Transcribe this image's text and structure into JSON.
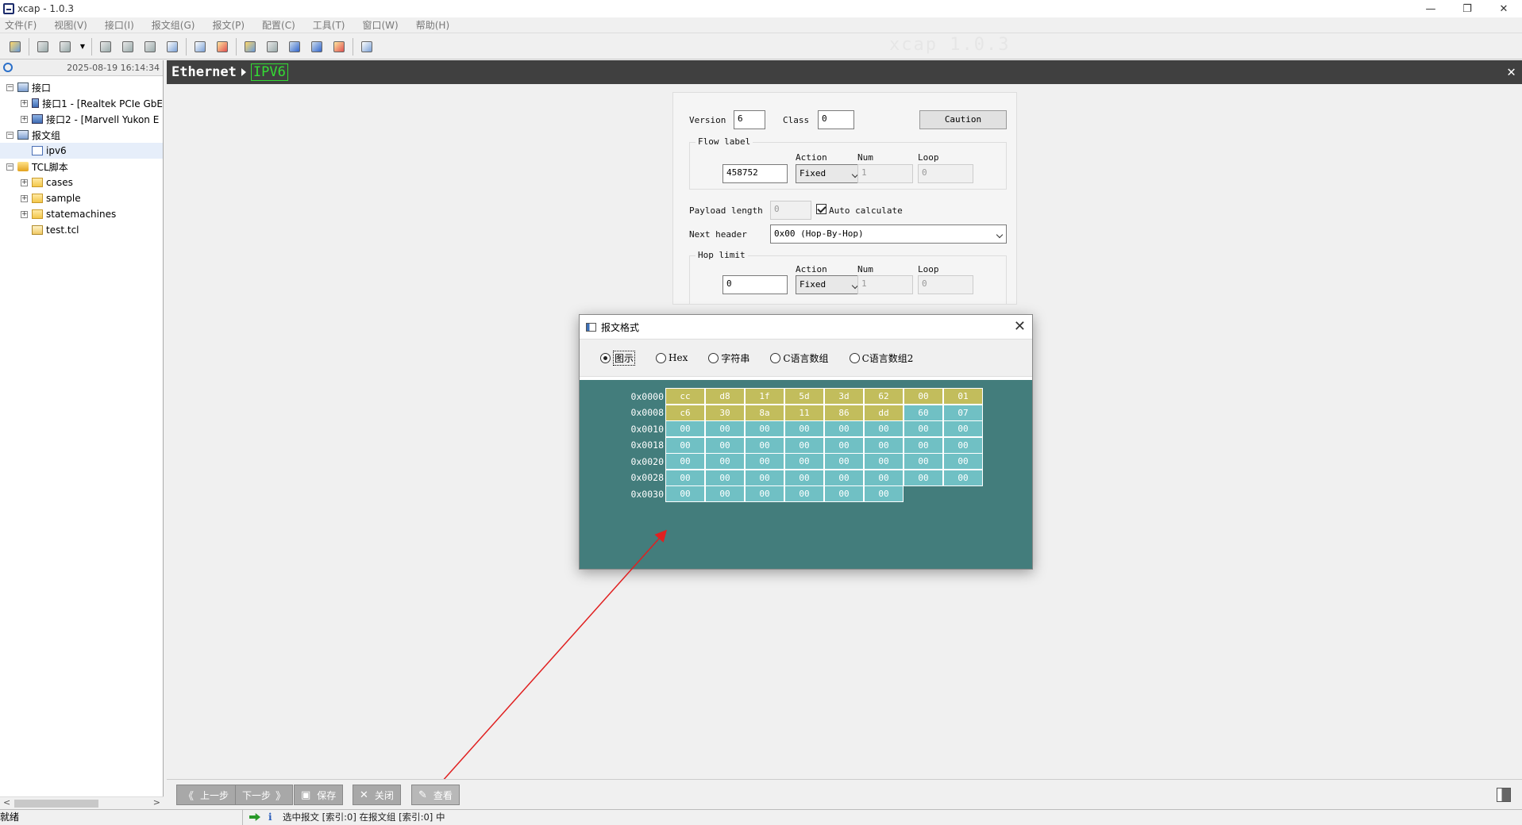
{
  "window": {
    "title": "xcap - 1.0.3",
    "controls": [
      "—",
      "❐",
      "✕"
    ]
  },
  "menu": [
    "文件(F)",
    "视图(V)",
    "接口(I)",
    "报文组(G)",
    "报文(P)",
    "配置(C)",
    "工具(T)",
    "窗口(W)",
    "帮助(H)"
  ],
  "watermark": "xcap 1.0.3",
  "sidebar": {
    "datetime": "2025-08-19 16:14:34",
    "tree": [
      {
        "label": "接口",
        "level": 0,
        "expander": "−",
        "icon": "nic-group"
      },
      {
        "label": "接口1 - [Realtek PCIe GbE",
        "level": 1,
        "expander": "+",
        "icon": "nic"
      },
      {
        "label": "接口2 - [Marvell Yukon E",
        "level": 1,
        "expander": "+",
        "icon": "nic"
      },
      {
        "label": "报文组",
        "level": 0,
        "expander": "−",
        "icon": "group"
      },
      {
        "label": "ipv6",
        "level": 1,
        "expander": "",
        "icon": "packet",
        "selected": true
      },
      {
        "label": "TCL脚本",
        "level": 0,
        "expander": "−",
        "icon": "tcl"
      },
      {
        "label": "cases",
        "level": 1,
        "expander": "+",
        "icon": "folder"
      },
      {
        "label": "sample",
        "level": 1,
        "expander": "+",
        "icon": "folder"
      },
      {
        "label": "statemachines",
        "level": 1,
        "expander": "+",
        "icon": "folder"
      },
      {
        "label": "test.tcl",
        "level": 1,
        "expander": "",
        "icon": "file"
      }
    ]
  },
  "breadcrumb": {
    "root": "Ethernet",
    "active": "IPV6",
    "close": "✕"
  },
  "ipv6_form": {
    "version_label": "Version",
    "version_value": "6",
    "class_label": "Class",
    "class_value": "0",
    "caution_button": "Caution",
    "flow_label_title": "Flow label",
    "flow": {
      "value": "458752",
      "action_label": "Action",
      "action": "Fixed",
      "num_label": "Num",
      "num": "1",
      "loop_label": "Loop",
      "loop": "0"
    },
    "payload_label": "Payload length",
    "payload_value": "0",
    "auto_calc_label": "Auto calculate",
    "next_header_label": "Next header",
    "next_header_value": "0x00 (Hop-By-Hop)",
    "hop_limit_title": "Hop limit",
    "hop": {
      "value": "0",
      "action_label": "Action",
      "action": "Fixed",
      "num_label": "Num",
      "num": "1",
      "loop_label": "Loop",
      "loop": "0"
    }
  },
  "dialog": {
    "title": "报文格式",
    "close": "✕",
    "radios": [
      {
        "label": "图示",
        "checked": true
      },
      {
        "label": "Hex",
        "checked": false
      },
      {
        "label": "字符串",
        "checked": false
      },
      {
        "label": "C语言数组",
        "checked": false
      },
      {
        "label": "C语言数组2",
        "checked": false
      }
    ],
    "hex_rows": [
      {
        "offset": "0x0000",
        "bytes": [
          "cc",
          "d8",
          "1f",
          "5d",
          "3d",
          "62",
          "00",
          "01"
        ],
        "header_count": 8
      },
      {
        "offset": "0x0008",
        "bytes": [
          "c6",
          "30",
          "8a",
          "11",
          "86",
          "dd",
          "60",
          "07"
        ],
        "header_count": 6
      },
      {
        "offset": "0x0010",
        "bytes": [
          "00",
          "00",
          "00",
          "00",
          "00",
          "00",
          "00",
          "00"
        ],
        "header_count": 0
      },
      {
        "offset": "0x0018",
        "bytes": [
          "00",
          "00",
          "00",
          "00",
          "00",
          "00",
          "00",
          "00"
        ],
        "header_count": 0
      },
      {
        "offset": "0x0020",
        "bytes": [
          "00",
          "00",
          "00",
          "00",
          "00",
          "00",
          "00",
          "00"
        ],
        "header_count": 0
      },
      {
        "offset": "0x0028",
        "bytes": [
          "00",
          "00",
          "00",
          "00",
          "00",
          "00",
          "00",
          "00"
        ],
        "header_count": 0
      },
      {
        "offset": "0x0030",
        "bytes": [
          "00",
          "00",
          "00",
          "00",
          "00",
          "00"
        ],
        "header_count": 0
      }
    ]
  },
  "bottom_buttons": [
    {
      "glyph": "《",
      "label": "上一步"
    },
    {
      "glyph": "》",
      "label": "下一步",
      "glyph_after": true
    },
    {
      "glyph": "▣",
      "label": "保存"
    },
    {
      "glyph": "✕",
      "label": "关闭"
    },
    {
      "glyph": "✎",
      "label": "查看"
    }
  ],
  "status": {
    "ready": "就绪",
    "message": "选中报文 [索引:0] 在报文组 [索引:0] 中"
  },
  "colors": {
    "hex_header": "#c2bd5c",
    "hex_data": "#70c0c4",
    "hex_bg": "#437d7c",
    "breadcrumb_active": "#33dd33",
    "annotation_arrow": "#e02020"
  }
}
